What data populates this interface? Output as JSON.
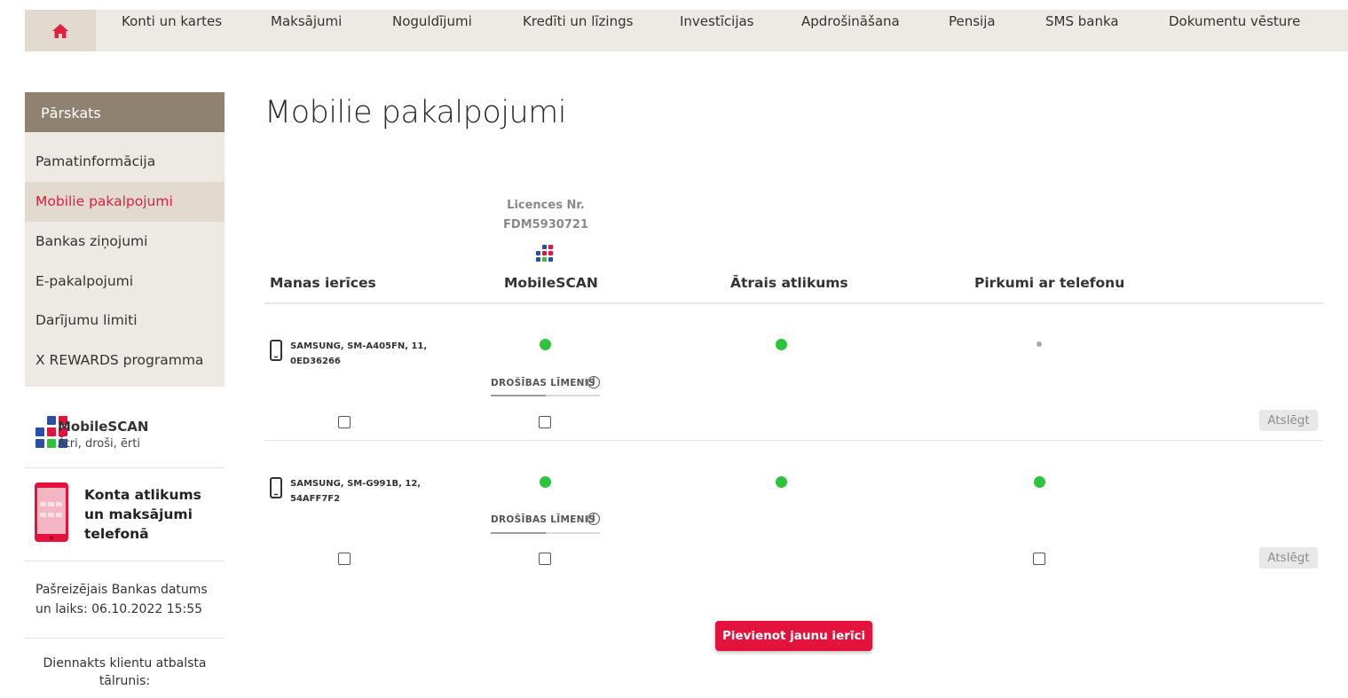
{
  "nav": {
    "home_icon": "home-icon",
    "items": [
      "Konti un kartes",
      "Maksājumi",
      "Noguldījumi",
      "Kredīti un līzings",
      "Investīcijas",
      "Apdrošināšana",
      "Pensija",
      "SMS banka",
      "Dokumentu vēsture"
    ]
  },
  "sidebar": {
    "header": "Pārskats",
    "items": [
      "Pamatinformācija",
      "Mobilie pakalpojumi",
      "Bankas ziņojumi",
      "E-pakalpojumi",
      "Darījumu limiti",
      "X REWARDS programma"
    ],
    "active_index": 1,
    "mobilescan_title": "MobileSCAN",
    "mobilescan_sub": "Ātri, droši, ērti",
    "balance_title": "Konta atlikums un maksājumi telefonā",
    "bank_date": "Pašreizējais Bankas datums un laiks: 06.10.2022 15:55",
    "support": "Diennakts klientu atbalsta tālrunis:"
  },
  "main": {
    "title": "Mobilie pakalpojumi",
    "license_label": "Licences Nr.",
    "license_number": "FDM5930721",
    "columns": [
      "Manas ierīces",
      "MobileSCAN",
      "Ātrais atlikums",
      "Pirkumi ar telefonu"
    ],
    "security_label": "DROŠĪBAS LĪMENIS",
    "info_glyph": "i",
    "disconnect_label": "Atslēgt",
    "add_device_label": "Pievienot jaunu ierīci",
    "devices": [
      {
        "name": "SAMSUNG, SM-A405FN, 11, 0ED36266",
        "mobilescan": "active",
        "quick_balance": "active",
        "phone_purchases": "inactive"
      },
      {
        "name": "SAMSUNG, SM-G991B, 12, 54AFF7F2",
        "mobilescan": "active",
        "quick_balance": "active",
        "phone_purchases": "active"
      }
    ]
  },
  "colors": {
    "accent_red": "#e3133d",
    "active_green": "#2dc33c",
    "nav_bg": "#ede9e4",
    "sidebar_header": "#8f8271"
  }
}
